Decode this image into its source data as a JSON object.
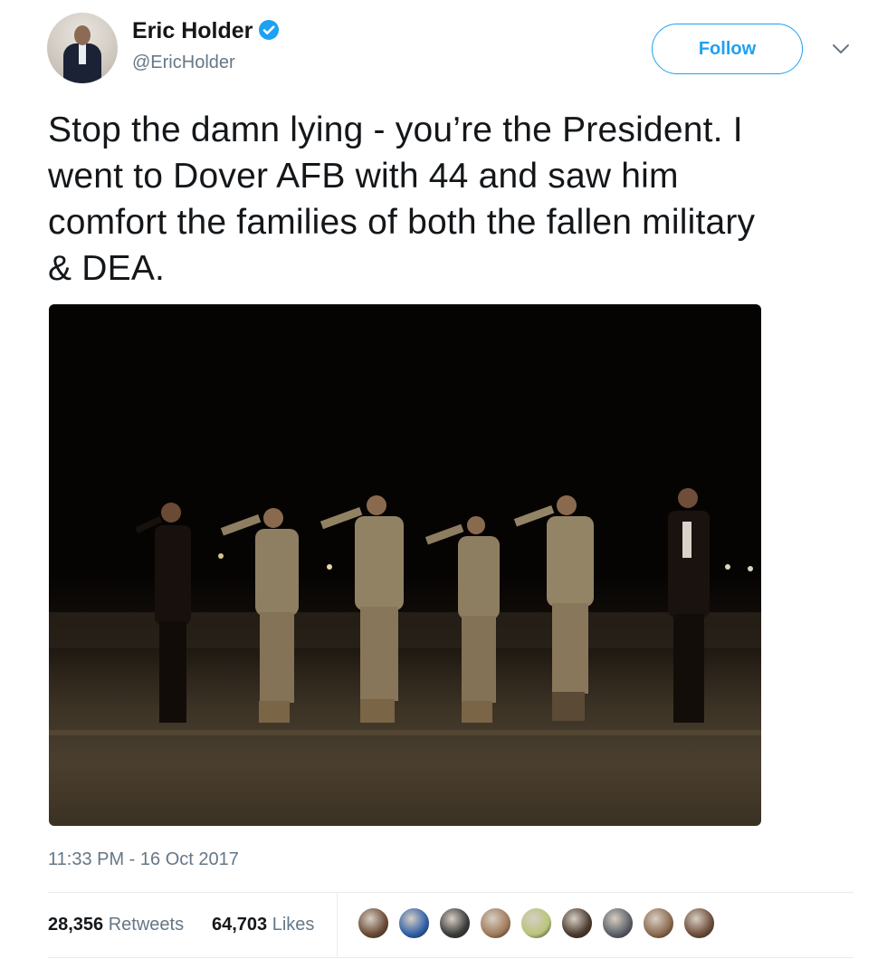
{
  "author": {
    "name": "Eric Holder",
    "handle": "@EricHolder",
    "verified_icon": "verified-badge-icon",
    "avatar_icon": "profile-photo-icon"
  },
  "actions": {
    "follow_label": "Follow",
    "menu_icon": "chevron-down-icon"
  },
  "tweet": {
    "text_lines": [
      "Stop the damn lying - you’re the President. I",
      "went to Dover AFB with 44 and saw him",
      "comfort the families of both the fallen military",
      "& DEA."
    ],
    "timestamp": "11:33 PM - 16 Oct 2017"
  },
  "stats": {
    "retweets_count": "28,356",
    "retweets_label": "Retweets",
    "likes_count": "64,703",
    "likes_label": "Likes"
  },
  "likers": [
    {
      "name": "liker-avatar-1",
      "color": "#6b4a35"
    },
    {
      "name": "liker-avatar-2",
      "color": "#2f5fa8"
    },
    {
      "name": "liker-avatar-3",
      "color": "#3b3b3b"
    },
    {
      "name": "liker-avatar-4",
      "color": "#a07a5a"
    },
    {
      "name": "liker-avatar-5",
      "color": "#b9c47a"
    },
    {
      "name": "liker-avatar-6",
      "color": "#4a3a30"
    },
    {
      "name": "liker-avatar-7",
      "color": "#5a5f66"
    },
    {
      "name": "liker-avatar-8",
      "color": "#8a6a4e"
    },
    {
      "name": "liker-avatar-9",
      "color": "#6e4d3b"
    }
  ],
  "colors": {
    "accent": "#1da1f2",
    "text_primary": "#14171a",
    "text_secondary": "#657786"
  }
}
